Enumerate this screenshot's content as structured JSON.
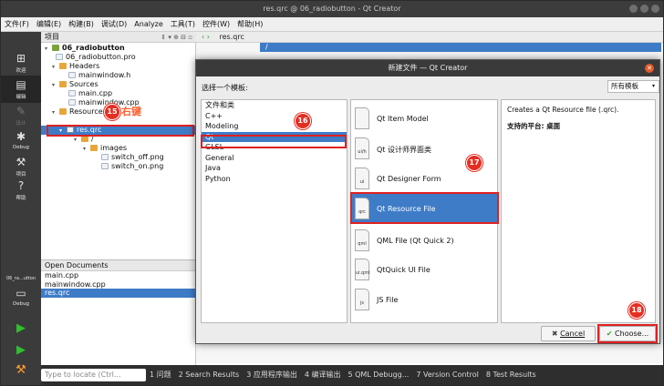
{
  "window": {
    "title": "res.qrc @ 06_radiobutton - Qt Creator"
  },
  "menu": [
    "文件(F)",
    "编辑(E)",
    "构建(B)",
    "调试(D)",
    "Analyze",
    "工具(T)",
    "控件(W)",
    "帮助(H)"
  ],
  "modes": [
    {
      "label": "欢迎",
      "icon": "grid-icon"
    },
    {
      "label": "编辑",
      "icon": "edit-icon"
    },
    {
      "label": "设计",
      "icon": "pencil-icon"
    },
    {
      "label": "Debug",
      "icon": "bug-icon"
    },
    {
      "label": "项目",
      "icon": "wrench-icon"
    },
    {
      "label": "帮助",
      "icon": "help-icon"
    }
  ],
  "kit": {
    "project": "06_ra...utton",
    "config": "Debug"
  },
  "sidebar": {
    "header": "项目",
    "tree": [
      {
        "label": "06_radiobutton"
      },
      {
        "label": "06_radiobutton.pro"
      },
      {
        "label": "Headers"
      },
      {
        "label": "mainwindow.h"
      },
      {
        "label": "Sources"
      },
      {
        "label": "main.cpp"
      },
      {
        "label": "mainwindow.cpp"
      },
      {
        "label": "Resources"
      },
      {
        "label": "res.qrc"
      },
      {
        "label": "/"
      },
      {
        "label": "images"
      },
      {
        "label": "switch_off.png"
      },
      {
        "label": "switch_on.png"
      }
    ],
    "open_docs_title": "Open Documents",
    "open_docs": [
      "main.cpp",
      "mainwindow.cpp",
      "res.qrc"
    ]
  },
  "editor": {
    "file": "res.qrc",
    "row": "/"
  },
  "dialog": {
    "title": "新建文件 — Qt Creator",
    "choose_label": "选择一个模板:",
    "filter": "所有模板",
    "categories": [
      "文件和类",
      "C++",
      "Modeling",
      "Qt",
      "GLSL",
      "General",
      "Java",
      "Python"
    ],
    "templates": [
      {
        "label": "Qt Item Model",
        "icon": ""
      },
      {
        "label": "Qt 设计师界面类",
        "icon": "ui/h"
      },
      {
        "label": "Qt Designer Form",
        "icon": "ui"
      },
      {
        "label": "Qt Resource File",
        "icon": "qrc"
      },
      {
        "label": "QML File (Qt Quick 2)",
        "icon": "qml"
      },
      {
        "label": "QtQuick UI File",
        "icon": "ui.qml"
      },
      {
        "label": "JS File",
        "icon": "js"
      }
    ],
    "description": "Creates a Qt Resource file (.qrc).",
    "platform": "支持的平台: 桌面",
    "cancel": "Cancel",
    "choose": "Choose..."
  },
  "annotations": {
    "callout": "右键",
    "badges": [
      "15",
      "16",
      "17",
      "18"
    ],
    "color": "#e02020"
  },
  "statusbar": {
    "locate": "Type to locate (Ctrl...",
    "items": [
      "1 问题",
      "2 Search Results",
      "3 应用程序输出",
      "4 编译输出",
      "5 QML Debugg...",
      "7 Version Control",
      "8 Test Results"
    ]
  }
}
